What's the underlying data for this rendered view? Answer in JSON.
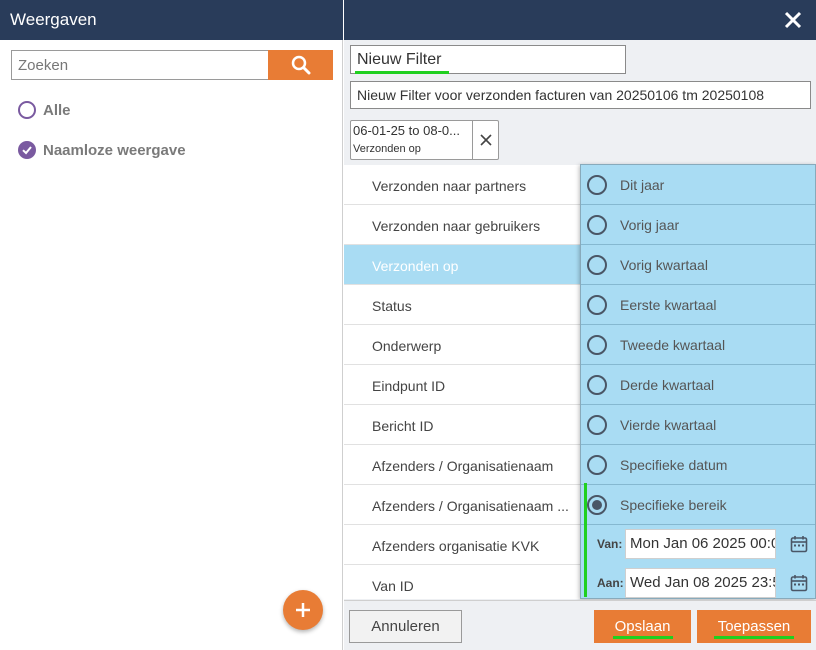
{
  "left": {
    "title": "Weergaven",
    "search_placeholder": "Zoeken",
    "views": [
      {
        "label": "Alle",
        "selected": false
      },
      {
        "label": "Naamloze weergave",
        "selected": true
      }
    ]
  },
  "filter": {
    "name": "Nieuw Filter",
    "description": "Nieuw Filter voor verzonden facturen van 20250106 tm 20250108",
    "chip": {
      "value": "06-01-25 to 08-0...",
      "label": "Verzonden op"
    }
  },
  "fields": [
    "Verzonden naar partners",
    "Verzonden naar gebruikers",
    "Verzonden op",
    "Status",
    "Onderwerp",
    "Eindpunt ID",
    "Bericht ID",
    "Afzenders / Organisatienaam",
    "Afzenders / Organisatienaam ...",
    "Afzenders organisatie KVK",
    "Van ID"
  ],
  "active_field": "Verzonden op",
  "options": [
    "Dit jaar",
    "Vorig jaar",
    "Vorig kwartaal",
    "Eerste kwartaal",
    "Tweede kwartaal",
    "Derde kwartaal",
    "Vierde kwartaal",
    "Specifieke datum",
    "Specifieke bereik"
  ],
  "selected_option": "Specifieke bereik",
  "range": {
    "from_label": "Van:",
    "from_value": "Mon Jan 06 2025 00:0",
    "to_label": "Aan:",
    "to_value": "Wed Jan 08 2025 23:5"
  },
  "footer": {
    "cancel": "Annuleren",
    "save": "Opslaan",
    "apply": "Toepassen"
  },
  "colors": {
    "header": "#293c5a",
    "accent": "#e87c35",
    "selection": "#a9dcf3",
    "radio": "#7a5aa0"
  },
  "icons": {
    "search": "search-icon",
    "close": "close-icon",
    "add": "plus-icon",
    "calendar": "calendar-icon"
  }
}
